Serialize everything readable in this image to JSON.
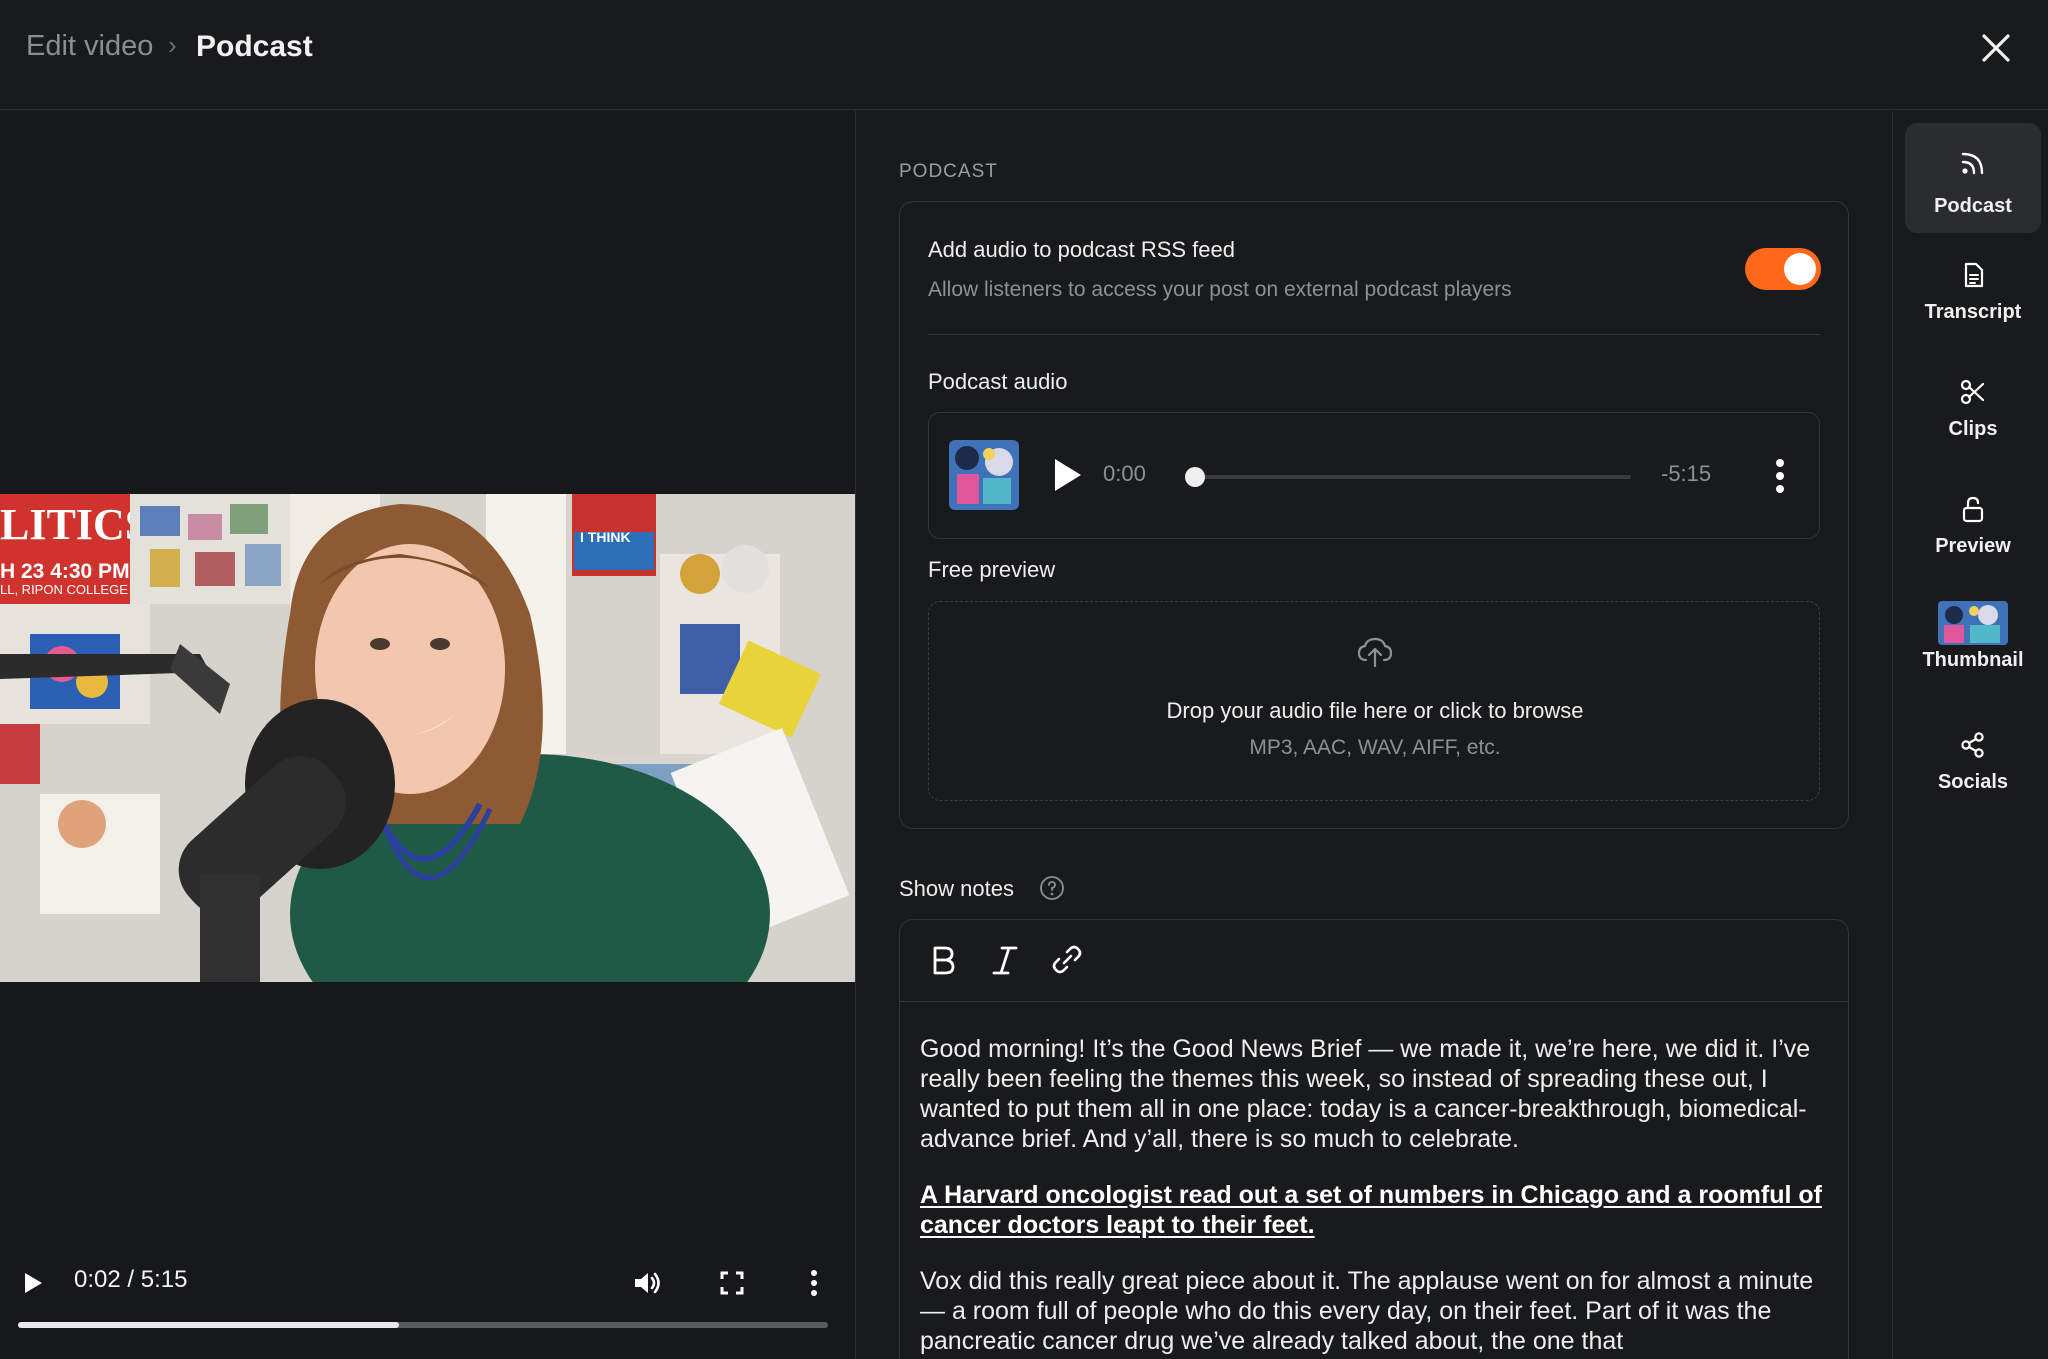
{
  "header": {
    "breadcrumb_parent": "Edit video",
    "breadcrumb_separator": "›",
    "breadcrumb_current": "Podcast"
  },
  "video": {
    "current_time": "0:02",
    "duration": "5:15",
    "time_display": "0:02 / 5:15",
    "progress_fraction": 0.47,
    "frame_text": {
      "sign_line1": "LITICS",
      "sign_line2": "H 23  4:30 PM",
      "sign_line3": "LL, RIPON COLLEGE",
      "poster_line": "I THINK"
    }
  },
  "podcast_section": {
    "section_label": "PODCAST",
    "rss_title": "Add audio to podcast RSS feed",
    "rss_subtitle": "Allow listeners to access your post on external podcast players",
    "rss_enabled": true,
    "audio_label": "Podcast audio",
    "player_current": "0:00",
    "player_remaining": "-5:15",
    "player_progress_fraction": 0.0,
    "free_preview_label": "Free preview",
    "drop_title": "Drop your audio file here or click to browse",
    "drop_formats": "MP3, AAC, WAV, AIFF, etc."
  },
  "show_notes": {
    "label": "Show notes",
    "paragraph1": "Good morning! It’s the Good News Brief — we made it, we’re here, we did it. I’ve really been feeling the themes this week, so instead of spreading these out, I wanted to put them all in one place: today is a cancer-breakthrough, biomedical-advance brief. And y’all, there is so much to celebrate.",
    "heading_link": "A Harvard oncologist read out a set of numbers in Chicago and a roomful of cancer doctors leapt to their feet.",
    "paragraph2": "Vox did this really great piece about it. The applause went on for almost a minute — a room full of people who do this every day, on their feet. Part of it was the pancreatic cancer drug we’ve already talked about, the one that"
  },
  "rail": {
    "items": [
      {
        "label": "Podcast",
        "icon": "rss-icon",
        "active": true
      },
      {
        "label": "Transcript",
        "icon": "document-icon",
        "active": false
      },
      {
        "label": "Clips",
        "icon": "scissors-icon",
        "active": false
      },
      {
        "label": "Preview",
        "icon": "unlock-icon",
        "active": false
      },
      {
        "label": "Thumbnail",
        "icon": "thumbnail-image",
        "active": false
      },
      {
        "label": "Socials",
        "icon": "share-icon",
        "active": false
      }
    ]
  },
  "colors": {
    "accent": "#ff6719",
    "background": "#191a1c",
    "border": "#33353a",
    "muted_text": "#8e9094"
  }
}
